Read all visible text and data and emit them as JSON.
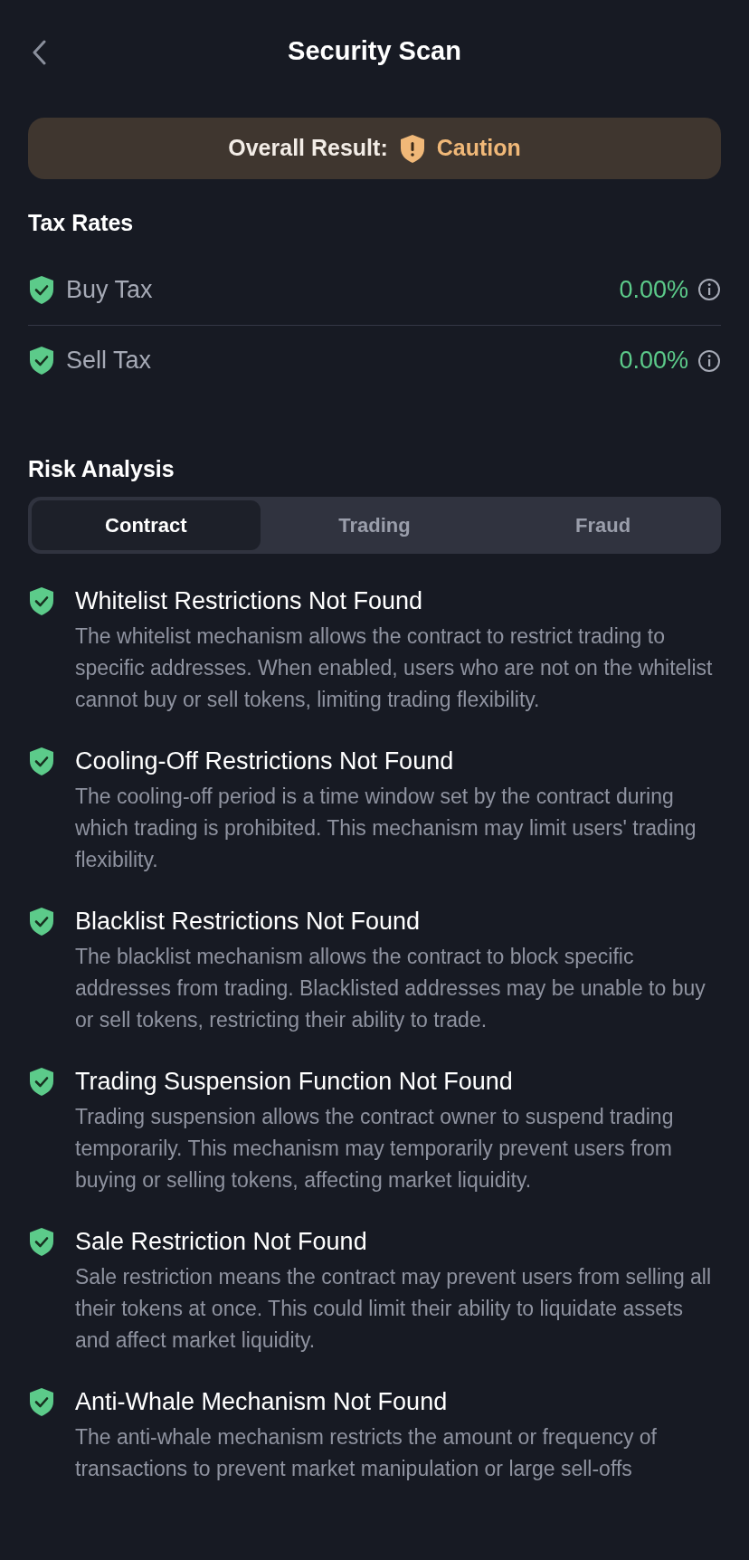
{
  "header": {
    "title": "Security Scan"
  },
  "overall": {
    "label": "Overall Result:",
    "kind": "caution",
    "value": "Caution"
  },
  "tax_rates": {
    "title": "Tax Rates",
    "rows": [
      {
        "label": "Buy Tax",
        "kind": "safe",
        "value": "0.00%"
      },
      {
        "label": "Sell Tax",
        "kind": "safe",
        "value": "0.00%"
      }
    ]
  },
  "risk_analysis": {
    "title": "Risk Analysis",
    "tabs": [
      {
        "label": "Contract",
        "selected": true
      },
      {
        "label": "Trading",
        "selected": false
      },
      {
        "label": "Fraud",
        "selected": false
      }
    ],
    "items": [
      {
        "kind": "safe",
        "title": "Whitelist Restrictions Not Found",
        "description": "The whitelist mechanism allows the contract to restrict trading to specific addresses. When enabled, users who are not on the whitelist cannot buy or sell tokens, limiting trading flexibility."
      },
      {
        "kind": "safe",
        "title": "Cooling-Off Restrictions Not Found",
        "description": "The cooling-off period is a time window set by the contract during which trading is prohibited. This mechanism may limit users' trading flexibility."
      },
      {
        "kind": "safe",
        "title": "Blacklist Restrictions Not Found",
        "description": "The blacklist mechanism allows the contract to block specific addresses from trading. Blacklisted addresses may be unable to buy or sell tokens, restricting their ability to trade."
      },
      {
        "kind": "safe",
        "title": "Trading Suspension Function Not Found",
        "description": "Trading suspension allows the contract owner to suspend trading temporarily. This mechanism may temporarily prevent users from buying or selling tokens, affecting market liquidity."
      },
      {
        "kind": "safe",
        "title": "Sale Restriction Not Found",
        "description": "Sale restriction means the contract may prevent users from selling all their tokens at once. This could limit their ability to liquidate assets and affect market liquidity."
      },
      {
        "kind": "safe",
        "title": "Anti-Whale Mechanism Not Found",
        "description": "The anti-whale mechanism restricts the amount or frequency of transactions to prevent market manipulation or large sell-offs"
      }
    ]
  }
}
